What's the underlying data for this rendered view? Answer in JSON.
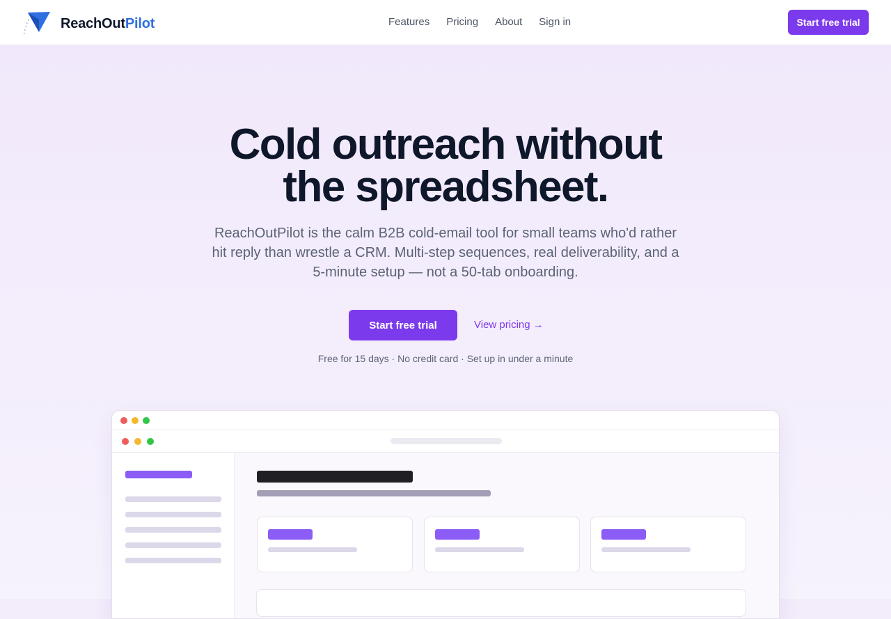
{
  "brand": {
    "name_part1": "ReachOut",
    "name_part2": "Pilot",
    "accent": "#2f6fe0",
    "icon": "paper-plane-icon"
  },
  "nav": {
    "links": [
      {
        "label": "Features"
      },
      {
        "label": "Pricing"
      },
      {
        "label": "About"
      },
      {
        "label": "Sign in"
      }
    ],
    "cta_label": "Start free trial"
  },
  "hero": {
    "headline_line1": "Cold outreach without",
    "headline_line2": "the spreadsheet.",
    "subhead": "ReachOutPilot is the calm B2B cold-email tool for small teams who'd rather hit reply than wrestle a CRM. Multi-step sequences, real deliverability, and a 5-minute setup — not a 50-tab onboarding.",
    "primary_cta": "Start free trial",
    "secondary_cta": "View pricing →",
    "fineprint": "Free for 15 days · No credit card · Set up in under a minute"
  },
  "colors": {
    "primary": "#7c3aed",
    "background": "#f3ecfb",
    "text": "#0f172a",
    "muted": "#5b6475"
  }
}
